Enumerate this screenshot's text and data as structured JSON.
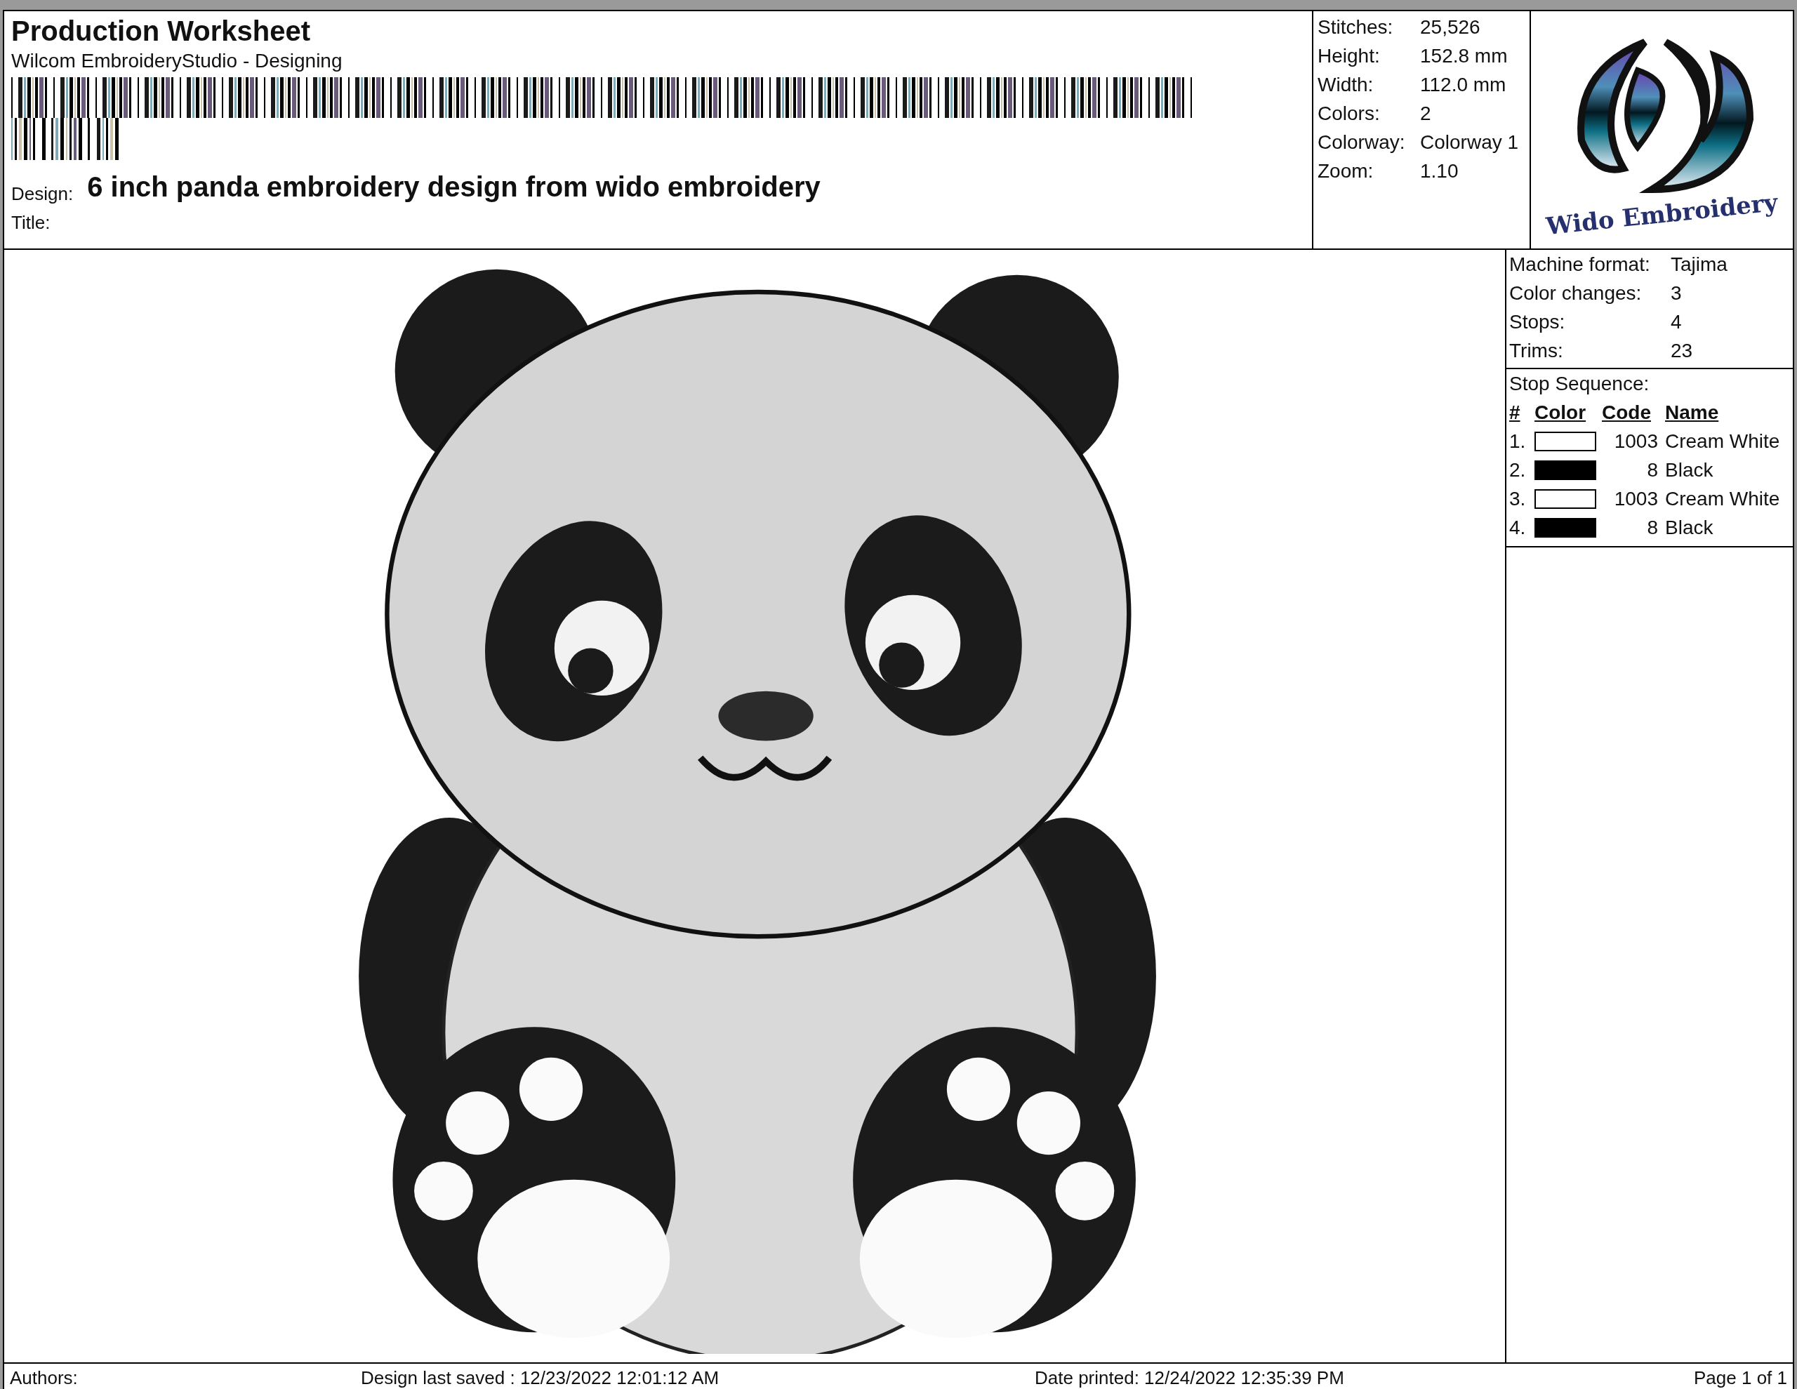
{
  "header": {
    "title": "Production Worksheet",
    "subtitle": "Wilcom EmbroideryStudio - Designing",
    "design_label": "Design:",
    "design_value": "6 inch panda embroidery design from wido embroidery",
    "title_label": "Title:"
  },
  "stats": [
    {
      "label": "Stitches:",
      "value": "25,526"
    },
    {
      "label": "Height:",
      "value": "152.8 mm"
    },
    {
      "label": "Width:",
      "value": "112.0 mm"
    },
    {
      "label": "Colors:",
      "value": "2"
    },
    {
      "label": "Colorway:",
      "value": "Colorway 1"
    },
    {
      "label": "Zoom:",
      "value": "1.10"
    }
  ],
  "logo": {
    "text": "Wido Embroidery"
  },
  "machine": [
    {
      "label": "Machine format:",
      "value": "Tajima"
    },
    {
      "label": "Color changes:",
      "value": "3"
    },
    {
      "label": "Stops:",
      "value": "4"
    },
    {
      "label": "Trims:",
      "value": "23"
    }
  ],
  "stop_sequence": {
    "title": "Stop Sequence:",
    "columns": [
      "#",
      "Color",
      "Code",
      "Name"
    ],
    "rows": [
      {
        "index": "1.",
        "color": "#ffffff",
        "code": "1003",
        "name": "Cream White"
      },
      {
        "index": "2.",
        "color": "#000000",
        "code": "8",
        "name": "Black"
      },
      {
        "index": "3.",
        "color": "#ffffff",
        "code": "1003",
        "name": "Cream White"
      },
      {
        "index": "4.",
        "color": "#000000",
        "code": "8",
        "name": "Black"
      }
    ]
  },
  "footer": {
    "authors": "Authors:",
    "saved": "Design last saved : 12/23/2022 12:01:12 AM",
    "printed": "Date printed: 12/24/2022 12:35:39 PM",
    "page": "Page 1 of 1"
  }
}
